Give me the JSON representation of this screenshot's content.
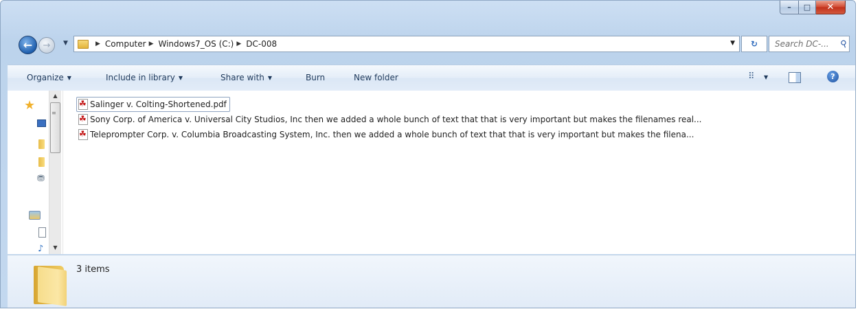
{
  "window": {
    "caption_buttons": {
      "minimize": "–",
      "maximize": "□",
      "close": "✕"
    }
  },
  "navigation": {
    "back_symbol": "←",
    "forward_symbol": "→",
    "breadcrumbs": [
      "Computer",
      "Windows7_OS (C:)",
      "DC-008"
    ],
    "refresh_symbol": "↻",
    "search_placeholder": "Search DC-..."
  },
  "command_bar": {
    "organize": "Organize",
    "include_in_library": "Include in library",
    "share_with": "Share with",
    "burn": "Burn",
    "new_folder": "New folder",
    "help": "?"
  },
  "files": [
    {
      "name": "Salinger v. Colting-Shortened.pdf",
      "focused": true
    },
    {
      "name": "Sony Corp. of America v. Universal City Studios, Inc then we added a whole bunch of text that that is very important but makes the filenames real..."
    },
    {
      "name": "Teleprompter Corp. v. Columbia Broadcasting System, Inc. then we added a whole bunch of text that that is very important but makes the filena..."
    }
  ],
  "details": {
    "item_count": "3 items"
  }
}
